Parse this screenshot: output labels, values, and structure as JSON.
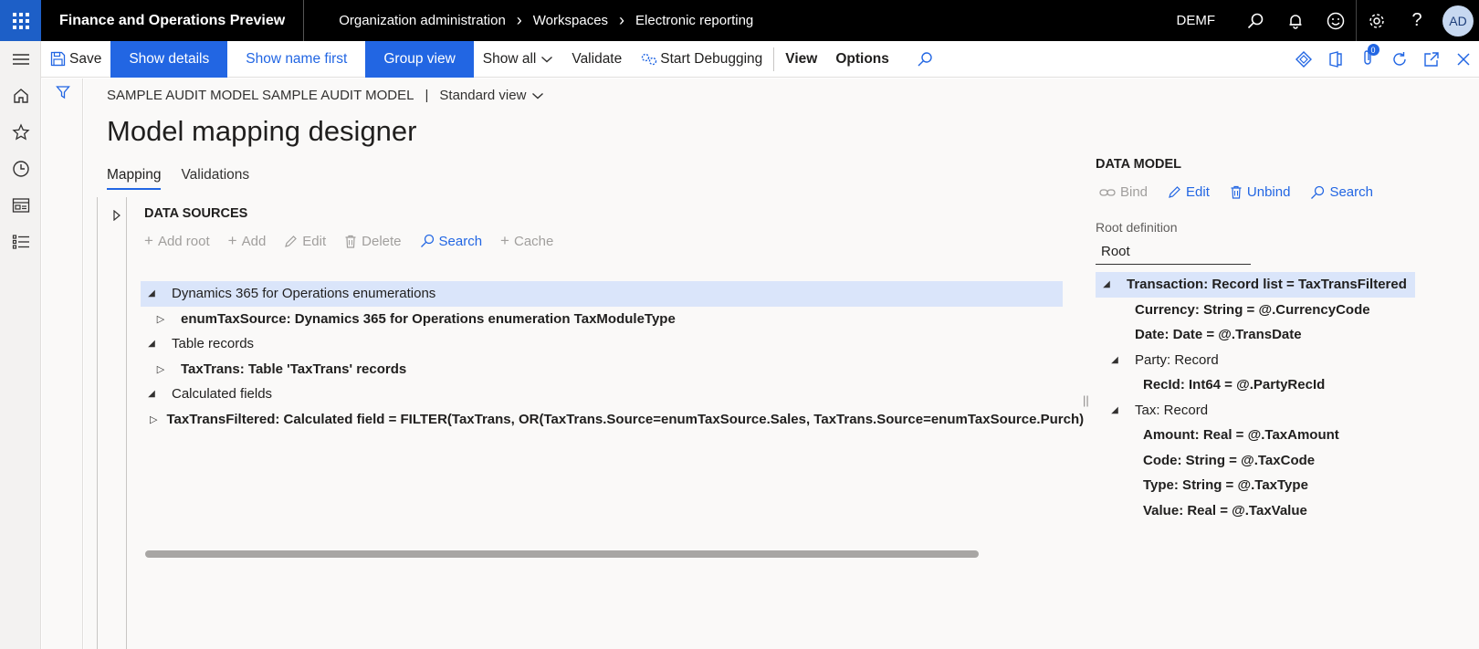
{
  "topbar": {
    "app_name": "Finance and Operations Preview",
    "breadcrumbs": [
      "Organization administration",
      "Workspaces",
      "Electronic reporting"
    ],
    "company": "DEMF",
    "user_initials": "AD"
  },
  "actionpane": {
    "save": "Save",
    "show_details": "Show details",
    "show_name_first": "Show name first",
    "group_view": "Group view",
    "show_all": "Show all",
    "validate": "Validate",
    "start_debugging": "Start Debugging",
    "view": "View",
    "options": "Options",
    "badge_count": "0"
  },
  "page": {
    "caption": "SAMPLE AUDIT MODEL SAMPLE AUDIT MODEL",
    "view_selector": "Standard view",
    "title": "Model mapping designer",
    "tabs": [
      "Mapping",
      "Validations"
    ]
  },
  "data_sources": {
    "header": "DATA SOURCES",
    "toolbar": {
      "add_root": "Add root",
      "add": "Add",
      "edit": "Edit",
      "delete": "Delete",
      "search": "Search",
      "cache": "Cache"
    },
    "tree": [
      {
        "label": "Dynamics 365 for Operations enumerations"
      },
      {
        "label": "enumTaxSource: Dynamics 365 for Operations enumeration TaxModuleType"
      },
      {
        "label": "Table records"
      },
      {
        "label": "TaxTrans: Table 'TaxTrans' records"
      },
      {
        "label": "Calculated fields"
      },
      {
        "label": "TaxTransFiltered: Calculated field = FILTER(TaxTrans, OR(TaxTrans.Source=enumTaxSource.Sales, TaxTrans.Source=enumTaxSource.Purch)"
      }
    ]
  },
  "data_model": {
    "header": "DATA MODEL",
    "toolbar": {
      "bind": "Bind",
      "edit": "Edit",
      "unbind": "Unbind",
      "search": "Search"
    },
    "root_definition_label": "Root definition",
    "root_definition_value": "Root",
    "tree": [
      {
        "label": "Transaction: Record list = TaxTransFiltered"
      },
      {
        "label": "Currency: String = @.CurrencyCode"
      },
      {
        "label": "Date: Date = @.TransDate"
      },
      {
        "label": "Party: Record"
      },
      {
        "label": "RecId: Int64 = @.PartyRecId"
      },
      {
        "label": "Tax: Record"
      },
      {
        "label": "Amount: Real = @.TaxAmount"
      },
      {
        "label": "Code: String = @.TaxCode"
      },
      {
        "label": "Type: String = @.TaxType"
      },
      {
        "label": "Value: Real = @.TaxValue"
      }
    ]
  },
  "colors": {
    "accent": "#2266e3",
    "topbar": "#000000",
    "selected_row": "#dae5fa"
  }
}
